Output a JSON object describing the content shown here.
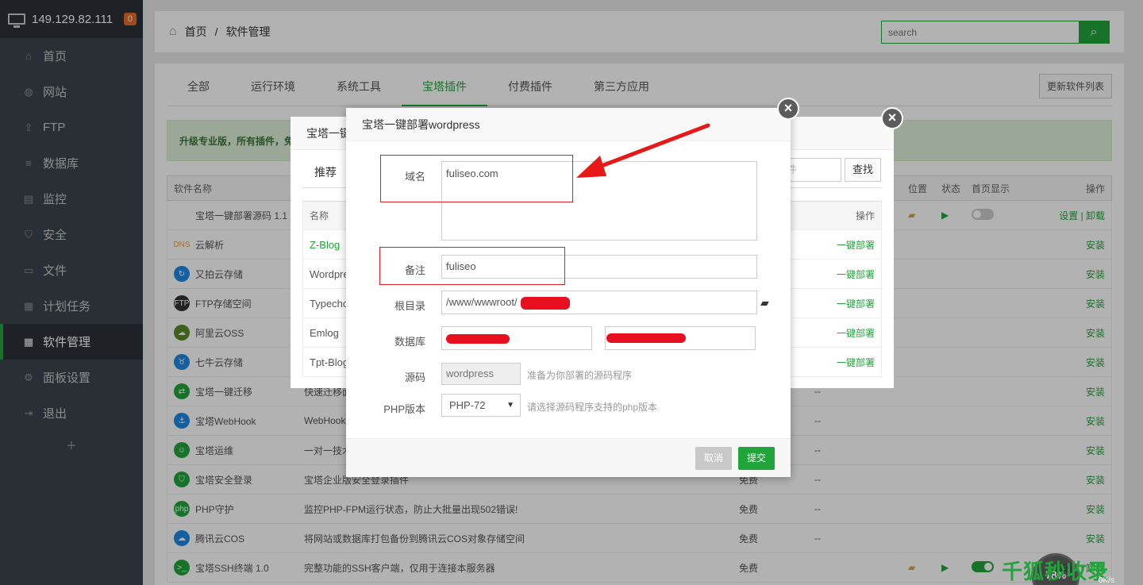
{
  "sidebar": {
    "server_ip": "149.129.82.111",
    "badge": "0",
    "items": [
      {
        "label": "首页",
        "icon": "home-icon"
      },
      {
        "label": "网站",
        "icon": "globe-icon"
      },
      {
        "label": "FTP",
        "icon": "ftp-icon"
      },
      {
        "label": "数据库",
        "icon": "database-icon"
      },
      {
        "label": "监控",
        "icon": "monitor-icon"
      },
      {
        "label": "安全",
        "icon": "shield-icon"
      },
      {
        "label": "文件",
        "icon": "folder-icon"
      },
      {
        "label": "计划任务",
        "icon": "calendar-icon"
      },
      {
        "label": "软件管理",
        "icon": "grid-icon",
        "active": true
      },
      {
        "label": "面板设置",
        "icon": "gear-icon"
      },
      {
        "label": "退出",
        "icon": "logout-icon"
      }
    ],
    "add_label": "+"
  },
  "header": {
    "breadcrumb_home": "首页",
    "breadcrumb_sep": "/",
    "breadcrumb_current": "软件管理",
    "search_placeholder": "search"
  },
  "tabs": [
    "全部",
    "运行环境",
    "系统工具",
    "宝塔插件",
    "付费插件",
    "第三方应用"
  ],
  "active_tab": "宝塔插件",
  "refresh_button": "更新软件列表",
  "notice": "升级专业版，所有插件，免",
  "table": {
    "headers": {
      "name": "软件名称",
      "pos": "位置",
      "state": "状态",
      "home": "首页显示",
      "action": "操作"
    },
    "rows": [
      {
        "name": "宝塔一键部署源码 1.1",
        "icon": "code-icon",
        "desc": "",
        "price": "",
        "dash": "",
        "action": "设置 | 卸载",
        "installed": true,
        "home_on": false
      },
      {
        "name": "云解析",
        "icon": "dns-icon",
        "desc": "",
        "price": "",
        "dash": "",
        "action": "安装"
      },
      {
        "name": "又拍云存储",
        "icon": "upyun-icon",
        "desc": "",
        "price": "",
        "dash": "",
        "action": "安装"
      },
      {
        "name": "FTP存储空间",
        "icon": "ftp-storage-icon",
        "desc": "",
        "price": "",
        "dash": "",
        "action": "安装"
      },
      {
        "name": "阿里云OSS",
        "icon": "aliyun-icon",
        "desc": "",
        "price": "",
        "dash": "",
        "action": "安装"
      },
      {
        "name": "七牛云存储",
        "icon": "qiniu-icon",
        "desc": "",
        "price": "",
        "dash": "",
        "action": "安装"
      },
      {
        "name": "宝塔一键迁移",
        "icon": "migrate-icon",
        "desc": "快速迁移面",
        "price": "",
        "dash": "--",
        "action": "安装"
      },
      {
        "name": "宝塔WebHook",
        "icon": "webhook-icon",
        "desc": "WebHook",
        "price": "",
        "dash": "--",
        "action": "安装"
      },
      {
        "name": "宝塔运维",
        "icon": "ops-icon",
        "desc": "一对一技术",
        "price": "",
        "dash": "--",
        "action": "安装"
      },
      {
        "name": "宝塔安全登录",
        "icon": "secure-login-icon",
        "desc": "宝塔企业版安全登录插件",
        "price": "免费",
        "dash": "--",
        "action": "安装"
      },
      {
        "name": "PHP守护",
        "icon": "php-icon",
        "desc": "监控PHP-FPM运行状态，防止大批量出现502错误!",
        "price": "免费",
        "dash": "--",
        "action": "安装"
      },
      {
        "name": "腾讯云COS",
        "icon": "tencent-cos-icon",
        "desc": "将网站或数据库打包备份到腾讯云COS对象存储空间",
        "price": "免费",
        "dash": "--",
        "action": "安装"
      },
      {
        "name": "宝塔SSH终端 1.0",
        "icon": "terminal-icon",
        "desc": "完整功能的SSH客户端，仅用于连接本服务器",
        "price": "免费",
        "dash": "",
        "action": "设置 | 卸载",
        "installed": true,
        "home_on": true
      }
    ]
  },
  "back_dialog": {
    "title": "宝塔一键",
    "tab": "推荐",
    "search_tail": "件",
    "search_btn": "查找",
    "headers": {
      "name": "名称",
      "action": "操作"
    },
    "rows": [
      {
        "name": "Z-Blog",
        "action": "一键部署"
      },
      {
        "name": "Wordpre",
        "action": "一键部署"
      },
      {
        "name": "Typecho",
        "action": "一键部署"
      },
      {
        "name": "Emlog",
        "action": "一键部署"
      },
      {
        "name": "Tpt-Blog",
        "action": "一键部署"
      }
    ]
  },
  "dialog": {
    "title": "宝塔一键部署wordpress",
    "domain_label": "域名",
    "domain_value": "fuliseo.com",
    "remark_label": "备注",
    "remark_value": "fuliseo",
    "root_label": "根目录",
    "root_value": "/www/wwwroot/",
    "db_label": "数据库",
    "source_label": "源码",
    "source_value": "wordpress",
    "source_hint": "准备为你部署的源码程序",
    "php_label": "PHP版本",
    "php_value": "PHP-72",
    "php_hint": "请选择源码程序支持的php版本",
    "cancel": "取消",
    "submit": "提交"
  },
  "overlay_texts": {
    "watermark": "千狐秒收录",
    "gauge": "78%",
    "speed": "0K/s"
  },
  "colors": {
    "accent": "#20a53a",
    "sidebar_bg": "#3c444d",
    "annotation_red": "#e02020"
  }
}
